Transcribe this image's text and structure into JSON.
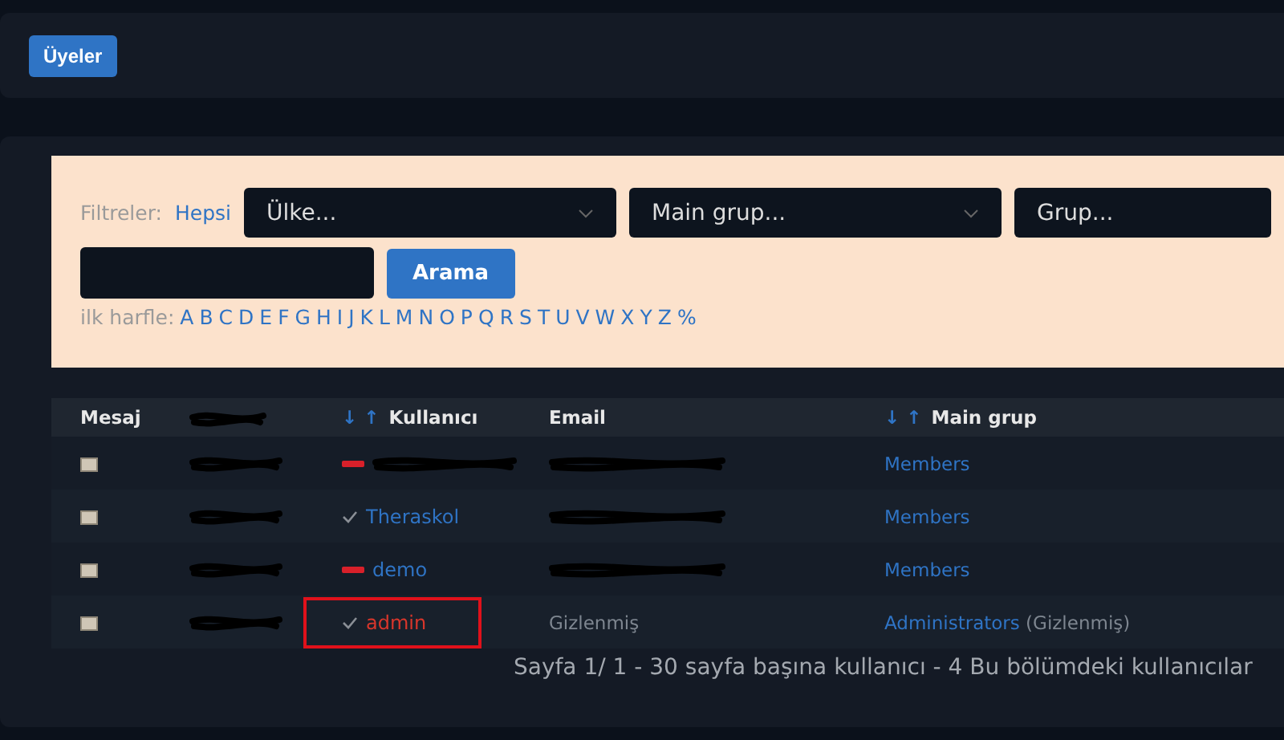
{
  "header": {
    "button": "Üyeler"
  },
  "filters": {
    "label": "Filtreler:",
    "all_link": "Hepsi",
    "selects": [
      {
        "placeholder": "Ülke..."
      },
      {
        "placeholder": "Main grup..."
      },
      {
        "placeholder": "Grup..."
      }
    ],
    "search_button": "Arama",
    "letters_label": "ilk harfle:",
    "letters": [
      "A",
      "B",
      "C",
      "D",
      "E",
      "F",
      "G",
      "H",
      "I",
      "J",
      "K",
      "L",
      "M",
      "N",
      "O",
      "P",
      "Q",
      "R",
      "S",
      "T",
      "U",
      "V",
      "W",
      "X",
      "Y",
      "Z",
      "%"
    ]
  },
  "table": {
    "columns": [
      {
        "label": "Mesaj"
      },
      {
        "redacted": true
      },
      {
        "label": "Kullanıcı",
        "sort_arrows": "↓ ↑"
      },
      {
        "label": "Email"
      },
      {
        "label": "Main grup",
        "sort_arrows": "↓ ↑"
      }
    ],
    "rows": [
      {
        "country": {
          "redacted": true
        },
        "online": false,
        "user": {
          "redacted": true
        },
        "email": {
          "redacted": true
        },
        "group": "Members",
        "highlighted": false
      },
      {
        "country": {
          "redacted": true
        },
        "online": true,
        "user": {
          "text": "Theraskol"
        },
        "email": {
          "redacted": true
        },
        "group": "Members",
        "highlighted": false
      },
      {
        "country": {
          "redacted": true
        },
        "online": false,
        "user": {
          "text": "demo"
        },
        "email": {
          "redacted": true
        },
        "group": "Members",
        "highlighted": false
      },
      {
        "country": {
          "redacted": true
        },
        "online": true,
        "user": {
          "text": "admin",
          "color": "#d9362b"
        },
        "email": {
          "text": "Gizlenmiş",
          "hidden": true
        },
        "group": "Administrators",
        "group_note": "(Gizlenmiş)",
        "highlighted": true
      }
    ]
  },
  "footer": "Sayfa 1/ 1 - 30 sayfa başına kullanıcı - 4 Bu bölümdeki kullanıcılar"
}
